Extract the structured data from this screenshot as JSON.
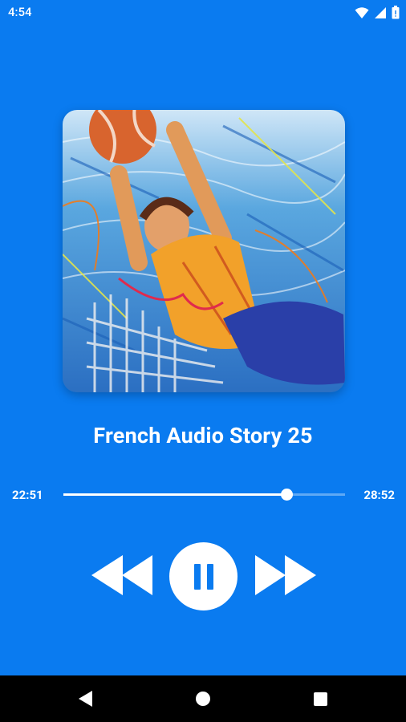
{
  "status_bar": {
    "time": "4:54",
    "icons": [
      "wifi-icon",
      "signal-icon",
      "battery-icon"
    ]
  },
  "album_art": {
    "icon": "album-art-image"
  },
  "track": {
    "title": "French Audio Story 25"
  },
  "player": {
    "elapsed": "22:51",
    "total": "28:52",
    "progress_fraction": 0.7925,
    "state": "playing"
  },
  "controls": {
    "rewind_icon": "rewind-icon",
    "pause_icon": "pause-icon",
    "forward_icon": "fast-forward-icon"
  },
  "nav_bar": {
    "back_icon": "back-icon",
    "home_icon": "home-icon",
    "recents_icon": "recents-icon"
  },
  "colors": {
    "background": "#0a7bf0",
    "foreground": "#ffffff",
    "nav_background": "#000000"
  }
}
